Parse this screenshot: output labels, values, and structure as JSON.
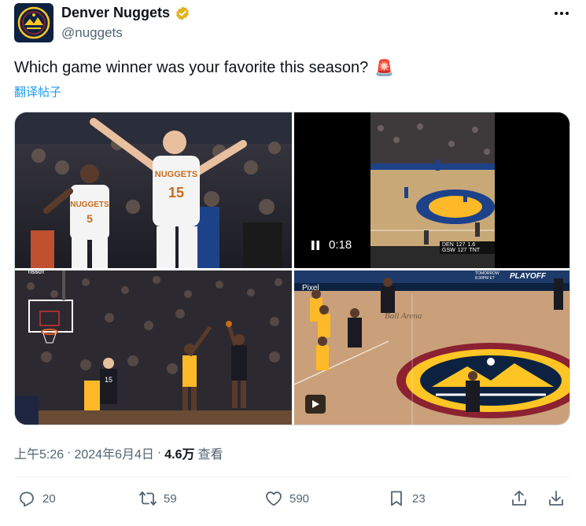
{
  "author": {
    "display_name": "Denver Nuggets",
    "handle": "@nuggets",
    "avatar_icon": "nuggets-logo-icon",
    "verified_color": "#e2b21d"
  },
  "tweet": {
    "text": "Which game winner was your favorite this season?",
    "emoji": "🚨",
    "translate_label": "翻译帖子"
  },
  "media": {
    "video_duration": "0:18",
    "scoreboard": {
      "team1": "DEN",
      "score1": "127",
      "team2": "GSW",
      "score2": "127",
      "time": "1.6",
      "network": "TNT"
    },
    "photo3_watermark": "TISSOT",
    "photo4_banner": "PLAYOFF",
    "photo4_banner_sub": "TOMORROW 8:30PM ET",
    "photo4_floor": "Ball Arena",
    "photo4_ad": "Pixel"
  },
  "meta": {
    "time": "上午5:26",
    "date": "2024年6月4日",
    "views_count": "4.6万",
    "views_label": "查看"
  },
  "actions": {
    "replies": "20",
    "reposts": "59",
    "likes": "590",
    "bookmarks": "23"
  },
  "colors": {
    "accent": "#1d9bf0",
    "secondary_text": "#536471",
    "nuggets_navy": "#0d2240",
    "nuggets_gold": "#fec524",
    "warriors_blue": "#1d428a",
    "lakers_gold": "#fdb927"
  }
}
